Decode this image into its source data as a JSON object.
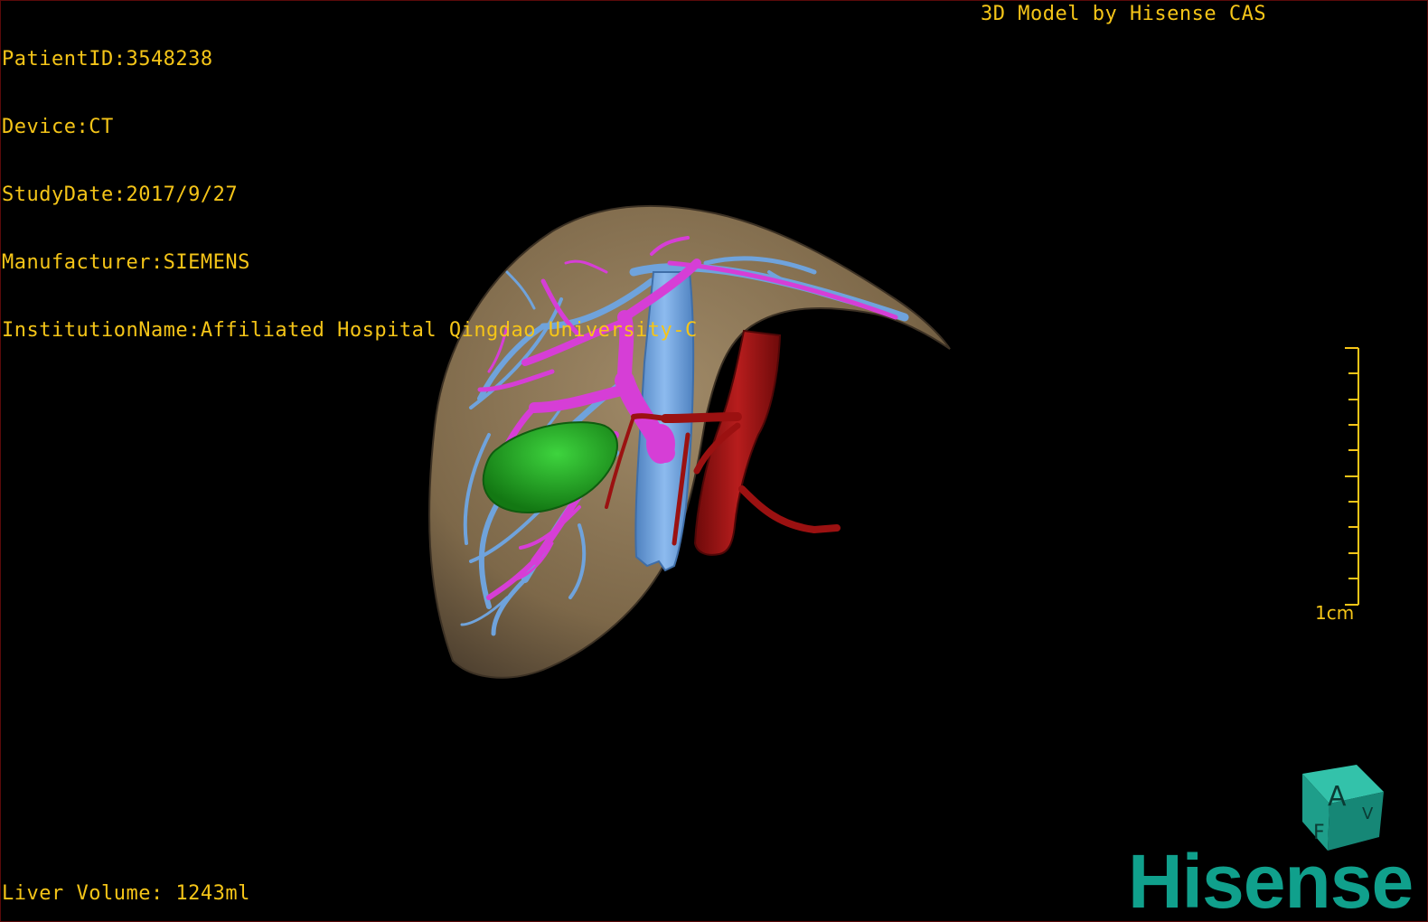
{
  "overlay": {
    "patient_id": "PatientID:3548238",
    "device": "Device:CT",
    "study_date": "StudyDate:2017/9/27",
    "manufacturer": "Manufacturer:SIEMENS",
    "institution": "InstitutionName:Affiliated Hospital Qingdao University-C",
    "model_credit": "3D Model by Hisense CAS",
    "liver_volume": "Liver Volume: 1243ml"
  },
  "scale_bar": {
    "label": "1cm"
  },
  "orientation_cube": {
    "face_front": "A",
    "face_bottom": "F",
    "face_side": "V"
  },
  "brand": {
    "logo_text": "Hisense"
  },
  "colors": {
    "overlay_text": "#f5c518",
    "liver": "#8b7456",
    "hepatic_veins": "#6fa3dc",
    "portal_vein": "#d63ed6",
    "artery_aorta": "#9b1111",
    "lesion": "#1fa31f",
    "brand": "#10a08c"
  }
}
